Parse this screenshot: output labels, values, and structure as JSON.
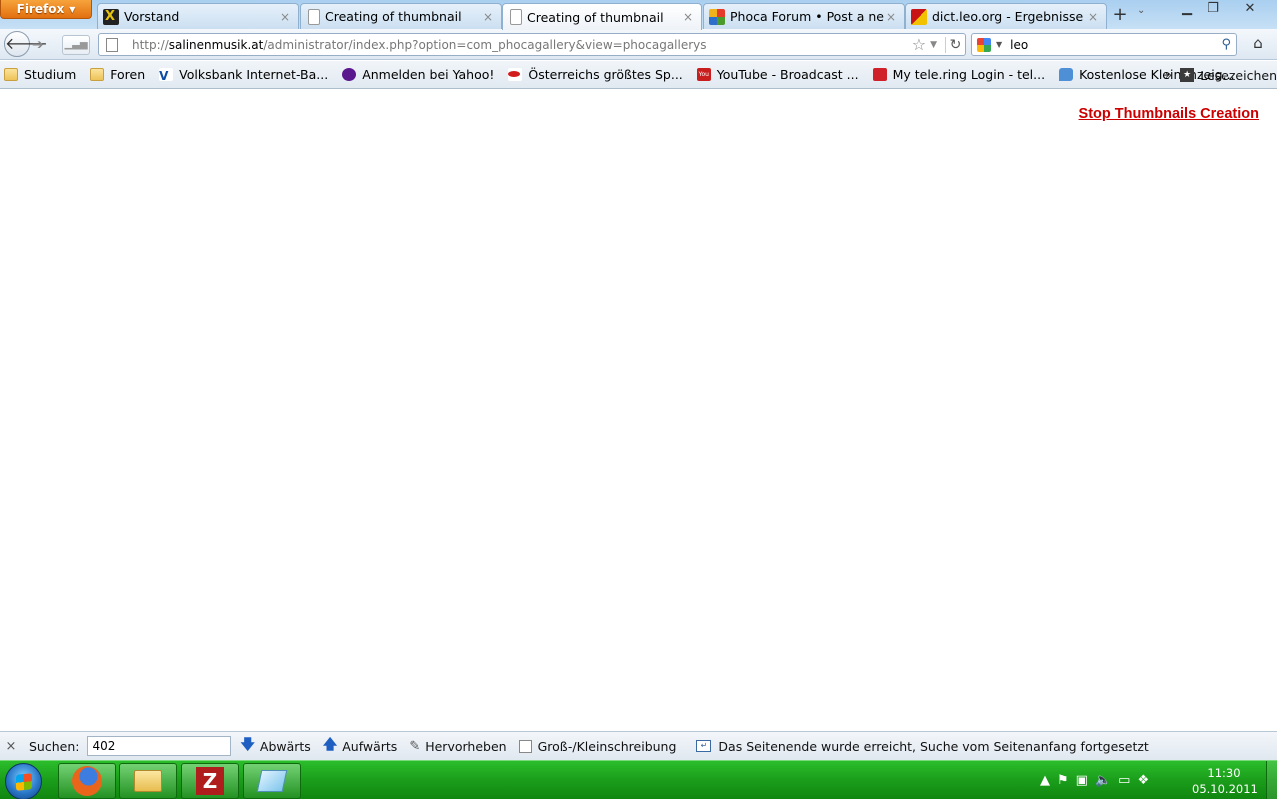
{
  "browser": {
    "menu_button": "Firefox",
    "tabs": [
      {
        "title": "Vorstand",
        "favicon": "xing-icon"
      },
      {
        "title": "Creating of thumbnail",
        "favicon": "document-icon"
      },
      {
        "title": "Creating of thumbnail",
        "favicon": "document-icon",
        "active": true
      },
      {
        "title": "Phoca Forum • Post a new t...",
        "favicon": "phoca-icon"
      },
      {
        "title": "dict.leo.org - Ergebnisse für ...",
        "favicon": "leo-icon"
      }
    ],
    "tab_close_glyph": "×",
    "new_tab_glyph": "+"
  },
  "navbar": {
    "url_prefix": "http://",
    "url_domain": "salinenmusik.at",
    "url_path": "/administrator/index.php?option=com_phocagallery&view=phocagallerys",
    "search_value": "leo"
  },
  "bookmarks": {
    "items": [
      {
        "label": "Studium",
        "icon": "folder-icon"
      },
      {
        "label": "Foren",
        "icon": "folder-icon"
      },
      {
        "label": "Volksbank Internet-Ba...",
        "icon": "volksbank-icon"
      },
      {
        "label": "Anmelden bei Yahoo!",
        "icon": "yahoo-icon"
      },
      {
        "label": "Österreichs größtes Sp...",
        "icon": "oe24-icon"
      },
      {
        "label": "YouTube - Broadcast ...",
        "icon": "youtube-icon"
      },
      {
        "label": "My tele.ring Login - tel...",
        "icon": "telering-icon"
      },
      {
        "label": "Kostenlose Kleinanzeig...",
        "icon": "chat-bubble-icon"
      }
    ],
    "overflow_label": "»",
    "bookmarks_menu_label": "Lesezeichen"
  },
  "content": {
    "stop_link": "Stop Thumbnails Creation"
  },
  "findbar": {
    "close_glyph": "×",
    "label": "Suchen:",
    "value": "402",
    "down_label": "Abwärts",
    "up_label": "Aufwärts",
    "highlight_label": "Hervorheben",
    "case_label": "Groß-/Kleinschreibung",
    "case_checked": false,
    "status": "Das Seitenende wurde erreicht, Suche vom Seitenanfang fortgesetzt"
  },
  "taskbar": {
    "apps": [
      "firefox-icon",
      "explorer-icon",
      "filezilla-icon",
      "notepad-icon"
    ],
    "time": "11:30",
    "date": "05.10.2011"
  },
  "colors": {
    "link_red": "#cc0000",
    "taskbar_green": "#1b9e1b",
    "firefox_orange": "#e2700f"
  }
}
